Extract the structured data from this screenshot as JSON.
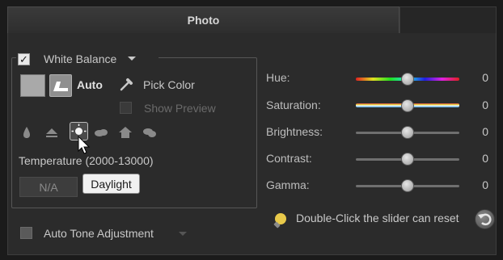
{
  "tabs": {
    "active_label": "Photo"
  },
  "white_balance": {
    "checked": true,
    "label": "White Balance",
    "auto_label": "Auto",
    "pick_color_label": "Pick Color",
    "show_preview_label": "Show Preview",
    "temperature_label": "Temperature (2000-13000)",
    "temperature_value": "N/A",
    "tooltip": "Daylight",
    "presets": [
      "candle",
      "fluorescent",
      "daylight",
      "cloudy",
      "shade",
      "overcast"
    ]
  },
  "auto_tone": {
    "checked": false,
    "label": "Auto Tone Adjustment"
  },
  "adjustments": [
    {
      "label": "Hue:",
      "value": "0",
      "slider": 0.5
    },
    {
      "label": "Saturation:",
      "value": "0",
      "slider": 0.5
    },
    {
      "label": "Brightness:",
      "value": "0",
      "slider": 0.5
    },
    {
      "label": "Contrast:",
      "value": "0",
      "slider": 0.5
    },
    {
      "label": "Gamma:",
      "value": "0",
      "slider": 0.5
    }
  ],
  "hint": {
    "text": "Double-Click the slider can reset",
    "icon": "lightbulb-icon"
  },
  "reset_icon": "undo-icon",
  "colors": {
    "panel": "#2b2b2b",
    "tooltip_bg": "#f1f1f1"
  }
}
